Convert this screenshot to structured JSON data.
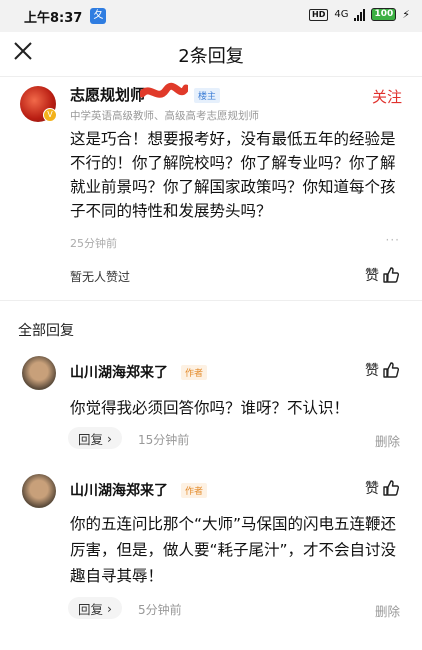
{
  "status": {
    "time": "上午8:37",
    "app_icon": "夂",
    "hd": "HD",
    "network": "4G",
    "battery": "100"
  },
  "header": {
    "title": "2条回复"
  },
  "op": {
    "name": "志愿规划师",
    "owner_tag": "楼主",
    "follow": "关注",
    "subtitle": "中学英语高级教师、高级高考志愿规划师",
    "body": "这是巧合！想要报考好，没有最低五年的经验是不行的！你了解院校吗？你了解专业吗？你了解就业前景吗？你了解国家政策吗？你知道每个孩子不同的特性和发展势头吗？",
    "time": "25分钟前",
    "more": "···",
    "no_likes": "暂无人赞过",
    "like": "赞"
  },
  "section_title": "全部回复",
  "replies": [
    {
      "name": "山川湖海郑来了",
      "tag": "作者",
      "like": "赞",
      "body": "你觉得我必须回答你吗？谁呀？不认识！",
      "reply_label": "回复",
      "time": "15分钟前",
      "delete": "删除"
    },
    {
      "name": "山川湖海郑来了",
      "tag": "作者",
      "like": "赞",
      "body": "你的五连问比那个“大师”马保国的闪电五连鞭还厉害，但是，做人要“耗子尾汁”，才不会自讨没趣自寻其辱！",
      "reply_label": "回复",
      "time": "5分钟前",
      "delete": "删除"
    }
  ],
  "colors": {
    "accent_red": "#e0322e",
    "owner_blue": "#3f7fd6",
    "author_orange": "#e38a2a"
  }
}
